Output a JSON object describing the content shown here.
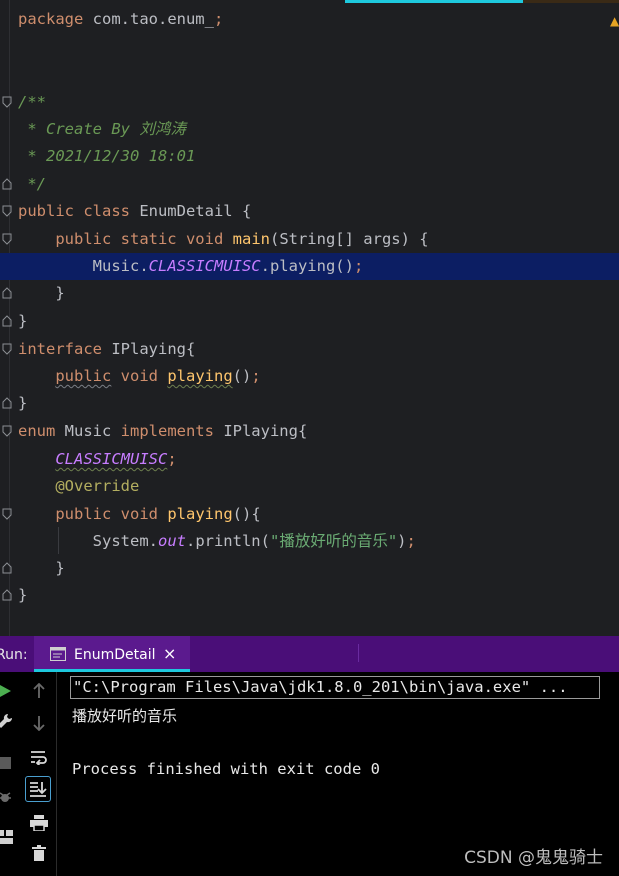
{
  "editor": {
    "lines": {
      "l1": {
        "kw": "package",
        "rest": " com.tao.enum_",
        "semi": ";"
      },
      "l4": "/**",
      "l5a": " * Create By ",
      "l5b": "刘鸿涛",
      "l6": " * 2021/12/30 18:01",
      "l7": " */",
      "l8": {
        "kw": "public class",
        "rest": " EnumDetail {"
      },
      "l9": {
        "kw": "    public static void",
        "fn": "main",
        "rest": "(String[] args) {"
      },
      "l10": {
        "pre": "        Music.",
        "field": "CLASSICMUISC",
        "rest": ".playing()",
        "semi": ";"
      },
      "l11": "    }",
      "l12": "}",
      "l13": {
        "kw": "interface",
        "rest": " IPlaying{"
      },
      "l14": {
        "pre": "    ",
        "kw1": "public",
        "kw2": " void ",
        "fn": "playing",
        "rest": "()",
        "semi": ";"
      },
      "l15": "}",
      "l16": {
        "kw": "enum",
        "rest1": " Music ",
        "kw2": "implements",
        "rest2": " IPlaying{"
      },
      "l17": {
        "pre": "    ",
        "field": "CLASSICMUISC",
        "semi": ";"
      },
      "l18": {
        "pre": "    ",
        "ann": "@Override"
      },
      "l19": {
        "kw": "    public void",
        "fn": "playing",
        "rest": "(){"
      },
      "l20": {
        "pre": "        System.",
        "field": "out",
        "rest1": ".println(",
        "str": "\"播放好听的音乐\"",
        "rest2": ")",
        "semi": ";"
      },
      "l21": "    }",
      "l22": "}"
    }
  },
  "runbar": {
    "label": "Run:",
    "tab_label": "EnumDetail",
    "close": "×"
  },
  "console": {
    "command": "\"C:\\Program Files\\Java\\jdk1.8.0_201\\bin\\java.exe\" ...",
    "output": "播放好听的音乐",
    "finished": "Process finished with exit code 0"
  },
  "watermark": "CSDN @鬼鬼骑士",
  "colors": {
    "accent": "#1ec9de",
    "runbar": "#4a0e78",
    "highlight": "#0c1e63"
  }
}
